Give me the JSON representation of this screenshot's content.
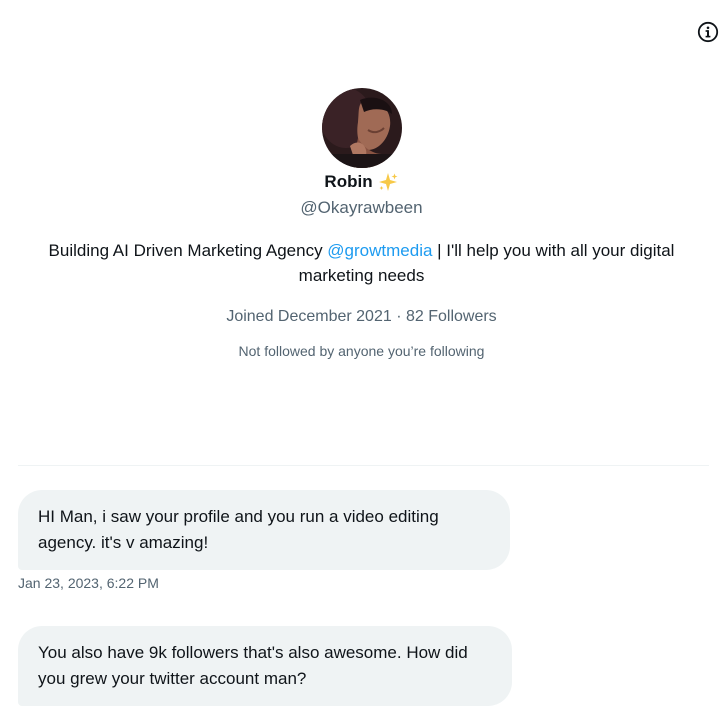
{
  "profile": {
    "name": "Robin",
    "handle": "@Okayrawbeen",
    "bio_before": "Building AI Driven Marketing Agency ",
    "bio_mention": "@growtmedia",
    "bio_after": " | I'll help you with all your digital marketing needs",
    "joined": "Joined December 2021",
    "followers": "82 Followers",
    "mutual_text": "Not followed by anyone you’re following"
  },
  "messages": [
    {
      "text": "HI Man, i saw your profile and you run a video editing agency. it's v amazing!",
      "timestamp": "Jan 23, 2023, 6:22 PM"
    },
    {
      "text": "You also have 9k followers that's also awesome. How did you grew your twitter account man?"
    }
  ],
  "icons": {
    "info": "info-icon",
    "sparkle": "sparkles-emoji"
  },
  "colors": {
    "accent": "#1d9bf0",
    "secondary_text": "#536471",
    "bubble": "#eff3f4"
  }
}
